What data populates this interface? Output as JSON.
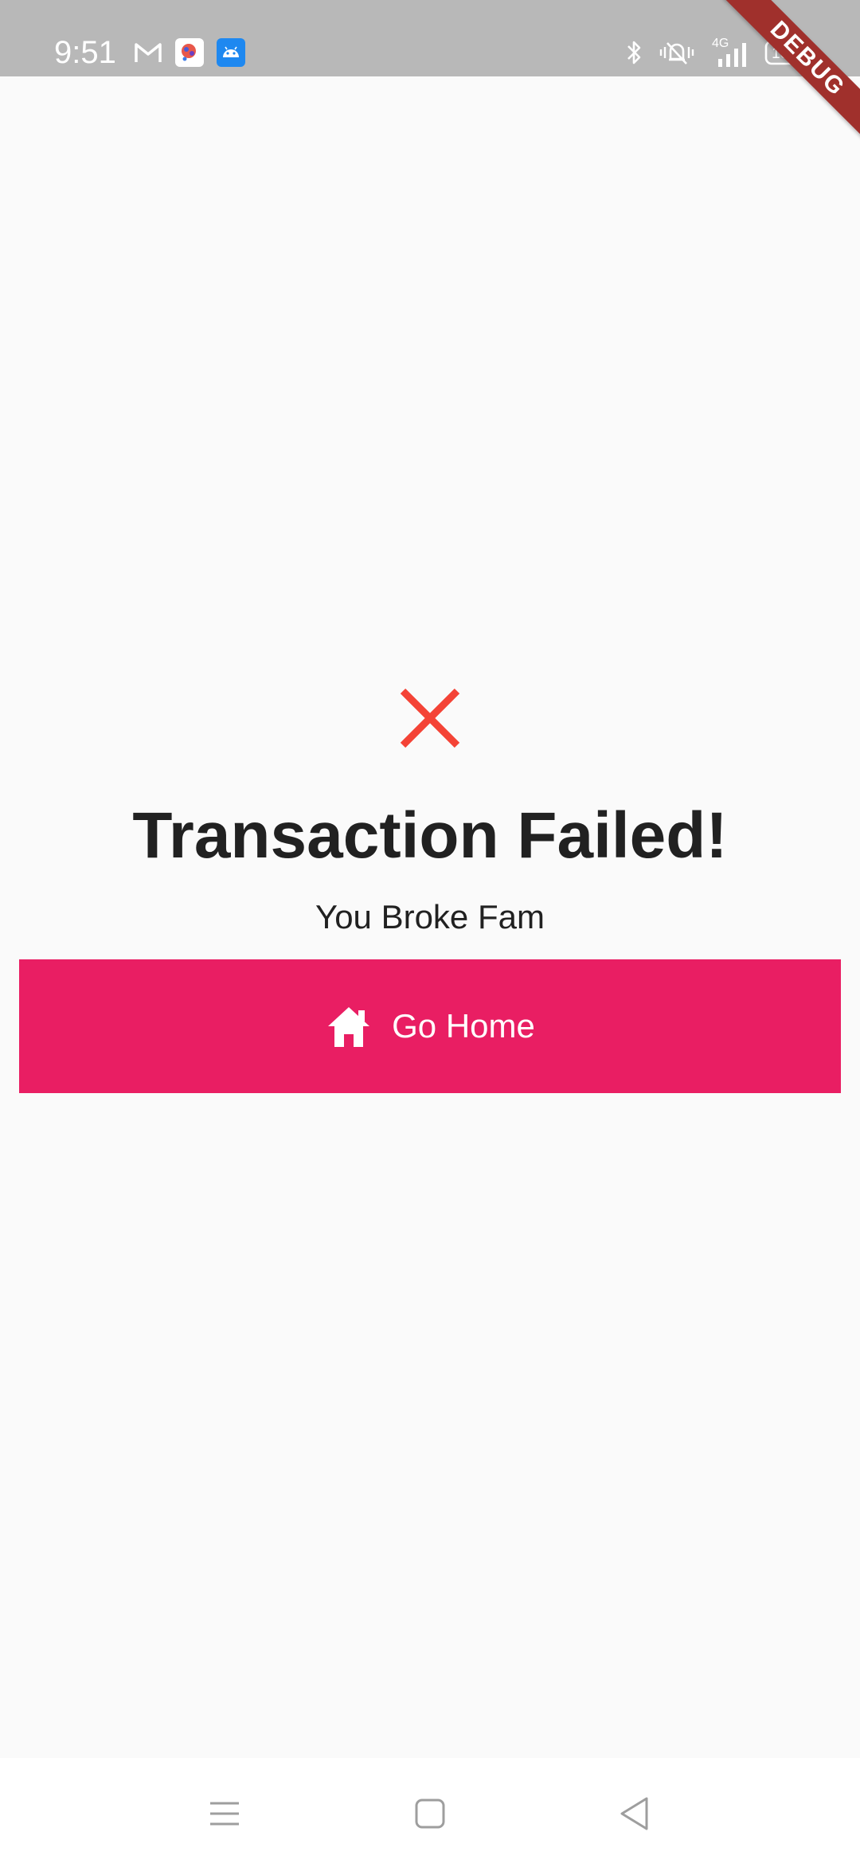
{
  "status_bar": {
    "time": "9:51",
    "left_icons": [
      "gmail-icon",
      "app-icon",
      "android-icon"
    ],
    "right_icons": [
      "bluetooth-icon",
      "vibrate-icon",
      "signal-icon",
      "battery-icon"
    ],
    "network": "4G",
    "battery": "100"
  },
  "debug_banner": "DEBUG",
  "main": {
    "status_icon": "close-icon",
    "status_color": "#F44336",
    "title": "Transaction Failed!",
    "subtitle": "You Broke Fam",
    "button": {
      "icon": "home-icon",
      "label": "Go Home",
      "color": "#E91E63"
    }
  },
  "nav_bar": {
    "items": [
      "menu-icon",
      "home-square-icon",
      "back-icon"
    ]
  }
}
